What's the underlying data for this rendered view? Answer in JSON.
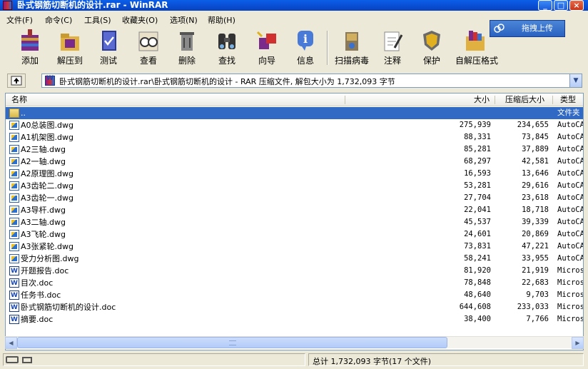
{
  "window": {
    "title": "卧式钢筋切断机的设计.rar - WinRAR"
  },
  "menu": [
    "文件(F)",
    "命令(C)",
    "工具(S)",
    "收藏夹(O)",
    "选项(N)",
    "帮助(H)"
  ],
  "toolbar": {
    "buttons": [
      "添加",
      "解压到",
      "测试",
      "查看",
      "删除",
      "查找",
      "向导",
      "信息",
      "扫描病毒",
      "注释",
      "保护",
      "自解压格式"
    ],
    "upload_label": "拖拽上传"
  },
  "address": {
    "path": "卧式钢筋切断机的设计.rar\\卧式钢筋切断机的设计 - RAR 压缩文件, 解包大小为 1,732,093 字节"
  },
  "columns": {
    "name": "名称",
    "size": "大小",
    "packed": "压缩后大小",
    "type": "类型"
  },
  "files": [
    {
      "name": "..",
      "size": "",
      "packed": "",
      "type": "文件夹",
      "kind": "folder"
    },
    {
      "name": "A0总装图.dwg",
      "size": "275,939",
      "packed": "234,655",
      "type": "AutoCAD",
      "kind": "dwg"
    },
    {
      "name": "A1机架图.dwg",
      "size": "88,331",
      "packed": "73,845",
      "type": "AutoCAD",
      "kind": "dwg"
    },
    {
      "name": "A2三轴.dwg",
      "size": "85,281",
      "packed": "37,889",
      "type": "AutoCAD",
      "kind": "dwg"
    },
    {
      "name": "A2一轴.dwg",
      "size": "68,297",
      "packed": "42,581",
      "type": "AutoCAD",
      "kind": "dwg"
    },
    {
      "name": "A2原理图.dwg",
      "size": "16,593",
      "packed": "13,646",
      "type": "AutoCAD",
      "kind": "dwg"
    },
    {
      "name": "A3齿轮二.dwg",
      "size": "53,281",
      "packed": "29,616",
      "type": "AutoCAD",
      "kind": "dwg"
    },
    {
      "name": "A3齿轮一.dwg",
      "size": "27,704",
      "packed": "23,618",
      "type": "AutoCAD",
      "kind": "dwg"
    },
    {
      "name": "A3导杆.dwg",
      "size": "22,041",
      "packed": "18,718",
      "type": "AutoCAD",
      "kind": "dwg"
    },
    {
      "name": "A3二轴.dwg",
      "size": "45,537",
      "packed": "39,339",
      "type": "AutoCAD",
      "kind": "dwg"
    },
    {
      "name": "A3飞轮.dwg",
      "size": "24,601",
      "packed": "20,869",
      "type": "AutoCAD",
      "kind": "dwg"
    },
    {
      "name": "A3张紧轮.dwg",
      "size": "73,831",
      "packed": "47,221",
      "type": "AutoCAD",
      "kind": "dwg"
    },
    {
      "name": "受力分析图.dwg",
      "size": "58,241",
      "packed": "33,955",
      "type": "AutoCAD",
      "kind": "dwg"
    },
    {
      "name": "开题报告.doc",
      "size": "81,920",
      "packed": "21,919",
      "type": "Microsoft",
      "kind": "doc"
    },
    {
      "name": "目次.doc",
      "size": "78,848",
      "packed": "22,683",
      "type": "Microsoft",
      "kind": "doc"
    },
    {
      "name": "任务书.doc",
      "size": "48,640",
      "packed": "9,703",
      "type": "Microsoft",
      "kind": "doc"
    },
    {
      "name": "卧式钢筋切断机的设计.doc",
      "size": "644,608",
      "packed": "233,033",
      "type": "Microsoft",
      "kind": "doc"
    },
    {
      "name": "摘要.doc",
      "size": "38,400",
      "packed": "7,766",
      "type": "Microsoft",
      "kind": "doc"
    }
  ],
  "status": {
    "summary": "总计 1,732,093 字节(17 个文件)"
  },
  "colors": {
    "titlebar": "#0842c0",
    "selection": "#316ac5",
    "face": "#ece9d8"
  }
}
